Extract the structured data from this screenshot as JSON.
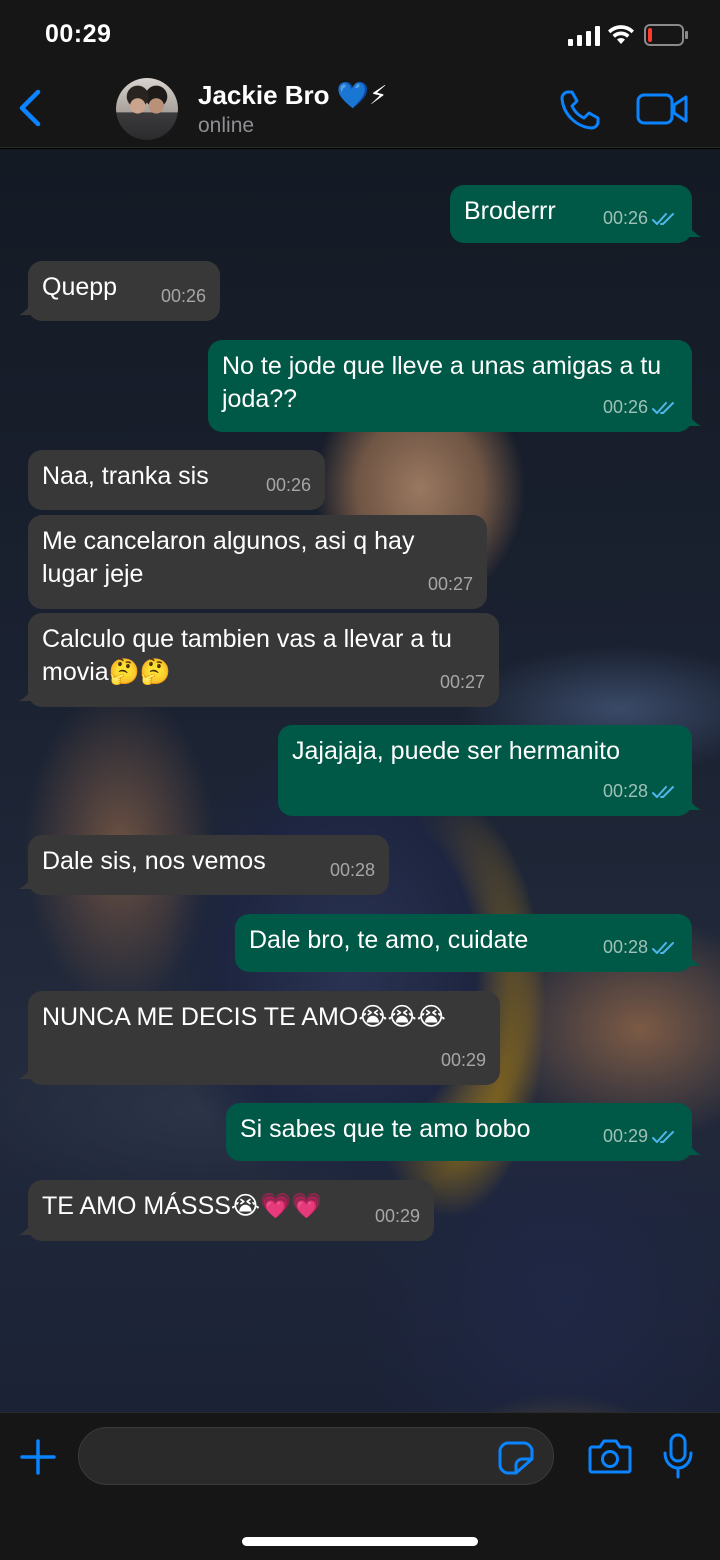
{
  "status_bar": {
    "time": "00:29",
    "icons": [
      "cellular-signal-icon",
      "wifi-icon",
      "battery-low-icon"
    ]
  },
  "header": {
    "contact_name": "Jackie Bro 💙⚡",
    "status": "online",
    "icons": [
      "back-chevron-icon",
      "phone-icon",
      "video-camera-icon"
    ]
  },
  "messages": [
    {
      "direction": "out",
      "text": "Broderrr",
      "time": "00:26",
      "read": true
    },
    {
      "direction": "in",
      "text": "Quepp",
      "time": "00:26"
    },
    {
      "direction": "out",
      "text": "No te jode que lleve a unas amigas a tu joda??",
      "time": "00:26",
      "read": true
    },
    {
      "direction": "in",
      "text": "Naa, tranka sis",
      "time": "00:26"
    },
    {
      "direction": "in",
      "text": "Me cancelaron algunos, asi q hay lugar jeje",
      "time": "00:27"
    },
    {
      "direction": "in",
      "text": "Calculo que tambien vas a llevar a tu movia🤔🤔",
      "time": "00:27"
    },
    {
      "direction": "out",
      "text": "Jajajaja, puede ser hermanito",
      "time": "00:28",
      "read": true
    },
    {
      "direction": "in",
      "text": "Dale sis, nos vemos",
      "time": "00:28"
    },
    {
      "direction": "out",
      "text": "Dale bro, te amo, cuidate",
      "time": "00:28",
      "read": true
    },
    {
      "direction": "in",
      "text": "NUNCA ME DECIS TE AMO😭😭😭",
      "time": "00:29"
    },
    {
      "direction": "out",
      "text": "Si sabes que te amo bobo",
      "time": "00:29",
      "read": true
    },
    {
      "direction": "in",
      "text": "TE AMO MÁSSS😭💗💗",
      "time": "00:29"
    }
  ],
  "input_bar": {
    "placeholder": "",
    "icons": [
      "plus-icon",
      "sticker-icon",
      "camera-icon",
      "microphone-icon"
    ]
  },
  "colors": {
    "accent": "#0a84ff",
    "incoming_bubble": "#383838",
    "outgoing_bubble": "#005846",
    "read_ticks": "#4fb6ec"
  }
}
